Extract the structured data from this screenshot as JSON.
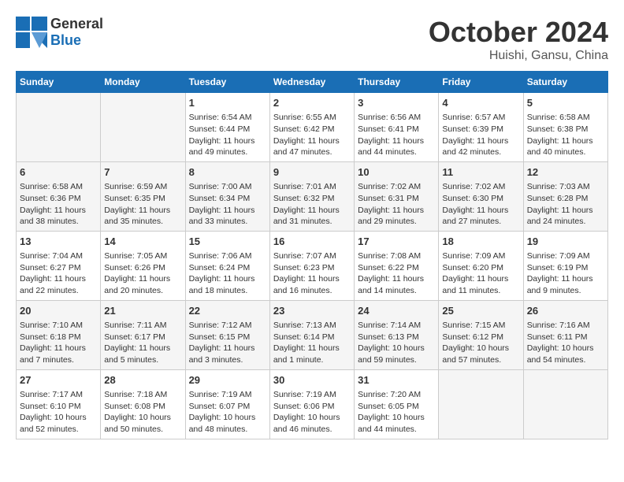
{
  "logo": {
    "line1": "General",
    "line2": "Blue"
  },
  "title": "October 2024",
  "subtitle": "Huishi, Gansu, China",
  "headers": [
    "Sunday",
    "Monday",
    "Tuesday",
    "Wednesday",
    "Thursday",
    "Friday",
    "Saturday"
  ],
  "weeks": [
    [
      {
        "day": "",
        "sunrise": "",
        "sunset": "",
        "daylight": ""
      },
      {
        "day": "",
        "sunrise": "",
        "sunset": "",
        "daylight": ""
      },
      {
        "day": "1",
        "sunrise": "Sunrise: 6:54 AM",
        "sunset": "Sunset: 6:44 PM",
        "daylight": "Daylight: 11 hours and 49 minutes."
      },
      {
        "day": "2",
        "sunrise": "Sunrise: 6:55 AM",
        "sunset": "Sunset: 6:42 PM",
        "daylight": "Daylight: 11 hours and 47 minutes."
      },
      {
        "day": "3",
        "sunrise": "Sunrise: 6:56 AM",
        "sunset": "Sunset: 6:41 PM",
        "daylight": "Daylight: 11 hours and 44 minutes."
      },
      {
        "day": "4",
        "sunrise": "Sunrise: 6:57 AM",
        "sunset": "Sunset: 6:39 PM",
        "daylight": "Daylight: 11 hours and 42 minutes."
      },
      {
        "day": "5",
        "sunrise": "Sunrise: 6:58 AM",
        "sunset": "Sunset: 6:38 PM",
        "daylight": "Daylight: 11 hours and 40 minutes."
      }
    ],
    [
      {
        "day": "6",
        "sunrise": "Sunrise: 6:58 AM",
        "sunset": "Sunset: 6:36 PM",
        "daylight": "Daylight: 11 hours and 38 minutes."
      },
      {
        "day": "7",
        "sunrise": "Sunrise: 6:59 AM",
        "sunset": "Sunset: 6:35 PM",
        "daylight": "Daylight: 11 hours and 35 minutes."
      },
      {
        "day": "8",
        "sunrise": "Sunrise: 7:00 AM",
        "sunset": "Sunset: 6:34 PM",
        "daylight": "Daylight: 11 hours and 33 minutes."
      },
      {
        "day": "9",
        "sunrise": "Sunrise: 7:01 AM",
        "sunset": "Sunset: 6:32 PM",
        "daylight": "Daylight: 11 hours and 31 minutes."
      },
      {
        "day": "10",
        "sunrise": "Sunrise: 7:02 AM",
        "sunset": "Sunset: 6:31 PM",
        "daylight": "Daylight: 11 hours and 29 minutes."
      },
      {
        "day": "11",
        "sunrise": "Sunrise: 7:02 AM",
        "sunset": "Sunset: 6:30 PM",
        "daylight": "Daylight: 11 hours and 27 minutes."
      },
      {
        "day": "12",
        "sunrise": "Sunrise: 7:03 AM",
        "sunset": "Sunset: 6:28 PM",
        "daylight": "Daylight: 11 hours and 24 minutes."
      }
    ],
    [
      {
        "day": "13",
        "sunrise": "Sunrise: 7:04 AM",
        "sunset": "Sunset: 6:27 PM",
        "daylight": "Daylight: 11 hours and 22 minutes."
      },
      {
        "day": "14",
        "sunrise": "Sunrise: 7:05 AM",
        "sunset": "Sunset: 6:26 PM",
        "daylight": "Daylight: 11 hours and 20 minutes."
      },
      {
        "day": "15",
        "sunrise": "Sunrise: 7:06 AM",
        "sunset": "Sunset: 6:24 PM",
        "daylight": "Daylight: 11 hours and 18 minutes."
      },
      {
        "day": "16",
        "sunrise": "Sunrise: 7:07 AM",
        "sunset": "Sunset: 6:23 PM",
        "daylight": "Daylight: 11 hours and 16 minutes."
      },
      {
        "day": "17",
        "sunrise": "Sunrise: 7:08 AM",
        "sunset": "Sunset: 6:22 PM",
        "daylight": "Daylight: 11 hours and 14 minutes."
      },
      {
        "day": "18",
        "sunrise": "Sunrise: 7:09 AM",
        "sunset": "Sunset: 6:20 PM",
        "daylight": "Daylight: 11 hours and 11 minutes."
      },
      {
        "day": "19",
        "sunrise": "Sunrise: 7:09 AM",
        "sunset": "Sunset: 6:19 PM",
        "daylight": "Daylight: 11 hours and 9 minutes."
      }
    ],
    [
      {
        "day": "20",
        "sunrise": "Sunrise: 7:10 AM",
        "sunset": "Sunset: 6:18 PM",
        "daylight": "Daylight: 11 hours and 7 minutes."
      },
      {
        "day": "21",
        "sunrise": "Sunrise: 7:11 AM",
        "sunset": "Sunset: 6:17 PM",
        "daylight": "Daylight: 11 hours and 5 minutes."
      },
      {
        "day": "22",
        "sunrise": "Sunrise: 7:12 AM",
        "sunset": "Sunset: 6:15 PM",
        "daylight": "Daylight: 11 hours and 3 minutes."
      },
      {
        "day": "23",
        "sunrise": "Sunrise: 7:13 AM",
        "sunset": "Sunset: 6:14 PM",
        "daylight": "Daylight: 11 hours and 1 minute."
      },
      {
        "day": "24",
        "sunrise": "Sunrise: 7:14 AM",
        "sunset": "Sunset: 6:13 PM",
        "daylight": "Daylight: 10 hours and 59 minutes."
      },
      {
        "day": "25",
        "sunrise": "Sunrise: 7:15 AM",
        "sunset": "Sunset: 6:12 PM",
        "daylight": "Daylight: 10 hours and 57 minutes."
      },
      {
        "day": "26",
        "sunrise": "Sunrise: 7:16 AM",
        "sunset": "Sunset: 6:11 PM",
        "daylight": "Daylight: 10 hours and 54 minutes."
      }
    ],
    [
      {
        "day": "27",
        "sunrise": "Sunrise: 7:17 AM",
        "sunset": "Sunset: 6:10 PM",
        "daylight": "Daylight: 10 hours and 52 minutes."
      },
      {
        "day": "28",
        "sunrise": "Sunrise: 7:18 AM",
        "sunset": "Sunset: 6:08 PM",
        "daylight": "Daylight: 10 hours and 50 minutes."
      },
      {
        "day": "29",
        "sunrise": "Sunrise: 7:19 AM",
        "sunset": "Sunset: 6:07 PM",
        "daylight": "Daylight: 10 hours and 48 minutes."
      },
      {
        "day": "30",
        "sunrise": "Sunrise: 7:19 AM",
        "sunset": "Sunset: 6:06 PM",
        "daylight": "Daylight: 10 hours and 46 minutes."
      },
      {
        "day": "31",
        "sunrise": "Sunrise: 7:20 AM",
        "sunset": "Sunset: 6:05 PM",
        "daylight": "Daylight: 10 hours and 44 minutes."
      },
      {
        "day": "",
        "sunrise": "",
        "sunset": "",
        "daylight": ""
      },
      {
        "day": "",
        "sunrise": "",
        "sunset": "",
        "daylight": ""
      }
    ]
  ]
}
